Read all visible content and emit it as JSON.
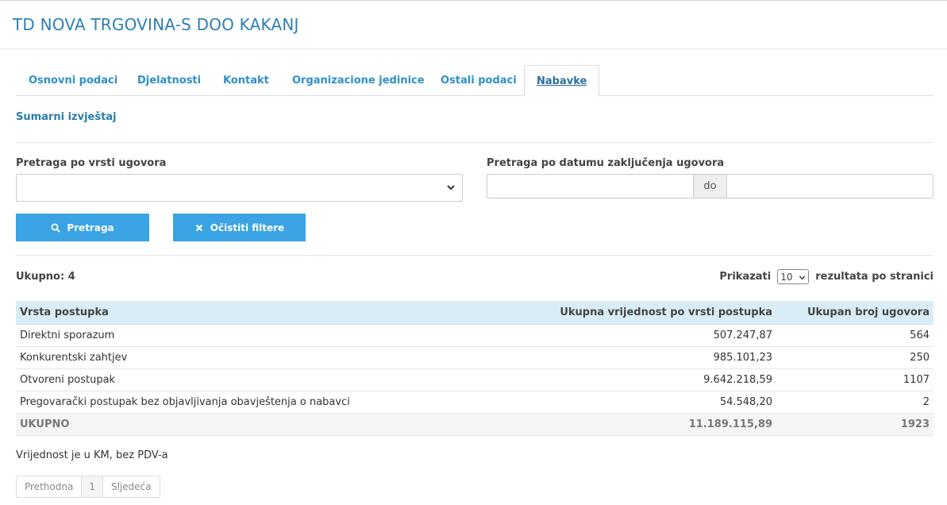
{
  "header": {
    "company": "TD NOVA TRGOVINA-S DOO KAKANJ"
  },
  "tabs": [
    {
      "label": "Osnovni podaci"
    },
    {
      "label": "Djelatnosti"
    },
    {
      "label": "Kontakt"
    },
    {
      "label": "Organizacione jedinice"
    },
    {
      "label": "Ostali podaci"
    },
    {
      "label": "Nabavke",
      "active": true
    }
  ],
  "section": {
    "title": "Sumarni izvještaj"
  },
  "filters": {
    "contract_type_label": "Pretraga po vrsti ugovora",
    "contract_type_value": "",
    "date_label": "Pretraga po datumu zaključenja ugovora",
    "date_from": "",
    "date_to": "",
    "date_separator": "do",
    "search_button": "Pretraga",
    "clear_button": "Očistiti filtere"
  },
  "summary": {
    "total_label": "Ukupno: 4",
    "show_label": "Prikazati",
    "page_size": "10",
    "per_page_label": "rezultata po stranici"
  },
  "table": {
    "headers": [
      "Vrsta postupka",
      "Ukupna vrijednost po vrsti postupka",
      "Ukupan broj ugovora"
    ],
    "rows": [
      [
        "Direktni sporazum",
        "507.247,87",
        "564"
      ],
      [
        "Konkurentski zahtjev",
        "985.101,23",
        "250"
      ],
      [
        "Otvoreni postupak",
        "9.642.218,59",
        "1107"
      ],
      [
        "Pregovarački postupak bez objavljivanja obavještenja o nabavci",
        "54.548,20",
        "2"
      ]
    ],
    "total": [
      "UKUPNO",
      "11.189.115,89",
      "1923"
    ]
  },
  "note": "Vrijednost je u KM, bez PDV-a",
  "pagination": {
    "prev": "Prethodna",
    "current": "1",
    "next": "Sljedeća"
  },
  "colors": {
    "accent": "#3aa3e3",
    "title": "#2d7fb5",
    "table_header": "#d9edf7"
  },
  "icons": {
    "search": "search-icon",
    "clear": "close-icon",
    "dropdown": "chevron-down-icon"
  }
}
